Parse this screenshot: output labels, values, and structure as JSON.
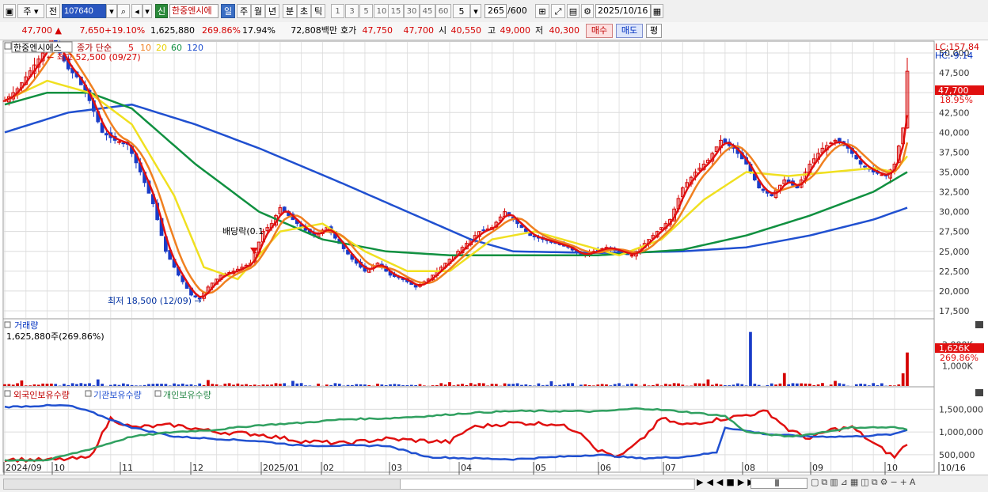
{
  "toolbar": {
    "type_label": "주",
    "prev_label": "전",
    "code": "107640",
    "new_badge": "신",
    "stock_name": "한중엔시에",
    "periods": [
      "일",
      "주",
      "월",
      "년",
      "분",
      "초",
      "틱"
    ],
    "active_period": "일",
    "intervals": [
      "1",
      "3",
      "5",
      "10",
      "15",
      "30",
      "45",
      "60"
    ],
    "interval_value": "5",
    "count_value": "265",
    "count_total": "/600",
    "date": "2025/10/16"
  },
  "quote": {
    "price": "47,700",
    "change": "7,650",
    "change_pct": "+19.10%",
    "volume": "1,625,880",
    "volume_ratio": "269.86%",
    "turnover": "17.94%",
    "amount": "72,808백만",
    "ask_label": "호가",
    "ask": "47,750",
    "bid": "47,700",
    "open_label": "시",
    "open": "40,550",
    "high_label": "고",
    "high": "49,000",
    "low_label": "저",
    "low": "40,300",
    "buy_label": "매수",
    "sell_label": "매도",
    "eval_label": "평"
  },
  "price_panel": {
    "legend_name": "한중엔시에스",
    "legend_ma_label": "종가 단순",
    "ma_periods": [
      "5",
      "10",
      "20",
      "60",
      "120"
    ],
    "lc_label": "LC:157.84",
    "hc_label": "HC:-9.14",
    "current_price_tag": "47,700",
    "current_pct_tag": "18.95%",
    "max_annotation": "최고 52,500 (09/27)",
    "min_annotation": "최저 18,500 (12/09)",
    "dividend_annotation": "배당락(0.1"
  },
  "volume_panel": {
    "title": "거래량",
    "value_text": "1,625,880주(269.86%)",
    "tag_value": "1,626K",
    "tag_pct": "269.86%"
  },
  "holder_panel": {
    "legend": [
      "외국인보유수량",
      "기관보유수량",
      "개인보유수량"
    ]
  },
  "x_axis_labels": [
    "2024/09",
    "10",
    "11",
    "12",
    "2025/01",
    "02",
    "03",
    "04",
    "05",
    "06",
    "07",
    "08",
    "09",
    "10",
    "10/16"
  ],
  "colors": {
    "up": "#d40000",
    "down": "#1a3cc8",
    "ma5": "#e01010",
    "ma10": "#f08020",
    "ma20": "#f0e020",
    "ma60": "#109040",
    "ma120": "#2050d0",
    "foreign": "#e01010",
    "institution": "#2050d0",
    "individual": "#30a060"
  },
  "chart_data": [
    {
      "type": "candlestick",
      "title": "한중엔시에스",
      "y_ticks": [
        17500,
        20000,
        22500,
        25000,
        27500,
        30000,
        32500,
        35000,
        37500,
        40000,
        42500,
        45000,
        47500,
        50000
      ],
      "ylim": [
        16500,
        51500
      ],
      "close_points": [
        [
          0,
          44000
        ],
        [
          3,
          45500
        ],
        [
          5,
          47000
        ],
        [
          7,
          48500
        ],
        [
          9,
          50000
        ],
        [
          11,
          52000
        ],
        [
          13,
          50000
        ],
        [
          15,
          48000
        ],
        [
          17,
          47000
        ],
        [
          20,
          44000
        ],
        [
          23,
          40000
        ],
        [
          26,
          39000
        ],
        [
          29,
          38500
        ],
        [
          32,
          35000
        ],
        [
          35,
          31000
        ],
        [
          38,
          25000
        ],
        [
          41,
          22000
        ],
        [
          44,
          19500
        ],
        [
          46,
          19000
        ],
        [
          48,
          20500
        ],
        [
          51,
          22000
        ],
        [
          54,
          22500
        ],
        [
          58,
          23500
        ],
        [
          61,
          27500
        ],
        [
          63,
          28500
        ],
        [
          65,
          30500
        ],
        [
          67,
          29500
        ],
        [
          70,
          28000
        ],
        [
          73,
          27000
        ],
        [
          76,
          28000
        ],
        [
          79,
          26000
        ],
        [
          82,
          24000
        ],
        [
          85,
          22500
        ],
        [
          88,
          23500
        ],
        [
          91,
          22000
        ],
        [
          94,
          21500
        ],
        [
          97,
          20500
        ],
        [
          100,
          21500
        ],
        [
          103,
          23000
        ],
        [
          106,
          24500
        ],
        [
          109,
          26000
        ],
        [
          112,
          27500
        ],
        [
          115,
          28000
        ],
        [
          118,
          30000
        ],
        [
          121,
          28500
        ],
        [
          124,
          27000
        ],
        [
          127,
          26500
        ],
        [
          130,
          26000
        ],
        [
          133,
          25500
        ],
        [
          136,
          24500
        ],
        [
          139,
          25000
        ],
        [
          142,
          25500
        ],
        [
          145,
          25000
        ],
        [
          148,
          24500
        ],
        [
          151,
          26000
        ],
        [
          154,
          27500
        ],
        [
          157,
          29000
        ],
        [
          160,
          33000
        ],
        [
          163,
          35000
        ],
        [
          166,
          36500
        ],
        [
          169,
          39000
        ],
        [
          172,
          38000
        ],
        [
          175,
          36000
        ],
        [
          178,
          33000
        ],
        [
          181,
          32000
        ],
        [
          184,
          34000
        ],
        [
          187,
          33000
        ],
        [
          190,
          36000
        ],
        [
          193,
          38000
        ],
        [
          196,
          39000
        ],
        [
          199,
          38000
        ],
        [
          202,
          36000
        ],
        [
          205,
          35000
        ],
        [
          208,
          34500
        ],
        [
          210,
          36000
        ],
        [
          212,
          40550
        ],
        [
          213,
          47700
        ]
      ],
      "ma20_points": [
        [
          0,
          44000
        ],
        [
          10,
          46500
        ],
        [
          20,
          45000
        ],
        [
          30,
          41000
        ],
        [
          40,
          32000
        ],
        [
          47,
          23000
        ],
        [
          55,
          21500
        ],
        [
          65,
          27500
        ],
        [
          75,
          28500
        ],
        [
          85,
          25000
        ],
        [
          95,
          22500
        ],
        [
          105,
          22500
        ],
        [
          115,
          26500
        ],
        [
          125,
          27500
        ],
        [
          135,
          26000
        ],
        [
          145,
          24500
        ],
        [
          155,
          26500
        ],
        [
          165,
          31500
        ],
        [
          175,
          35000
        ],
        [
          185,
          34500
        ],
        [
          195,
          35000
        ],
        [
          205,
          35500
        ],
        [
          210,
          35000
        ],
        [
          213,
          37000
        ]
      ],
      "ma60_points": [
        [
          0,
          43500
        ],
        [
          10,
          45000
        ],
        [
          20,
          45000
        ],
        [
          30,
          43000
        ],
        [
          45,
          36000
        ],
        [
          60,
          30000
        ],
        [
          75,
          26500
        ],
        [
          90,
          25000
        ],
        [
          105,
          24500
        ],
        [
          120,
          24500
        ],
        [
          140,
          24500
        ],
        [
          160,
          25200
        ],
        [
          175,
          27000
        ],
        [
          190,
          29500
        ],
        [
          205,
          32500
        ],
        [
          213,
          35000
        ]
      ],
      "ma120_points": [
        [
          0,
          40000
        ],
        [
          15,
          42500
        ],
        [
          30,
          43500
        ],
        [
          45,
          41000
        ],
        [
          60,
          38000
        ],
        [
          80,
          33500
        ],
        [
          95,
          30000
        ],
        [
          110,
          26500
        ],
        [
          120,
          25000
        ],
        [
          140,
          24800
        ],
        [
          160,
          25000
        ],
        [
          175,
          25500
        ],
        [
          190,
          27000
        ],
        [
          205,
          29000
        ],
        [
          213,
          30500
        ]
      ],
      "annotations": [
        "최고 52,500 (09/27)",
        "최저 18,500 (12/09)"
      ]
    },
    {
      "type": "bar",
      "title": "거래량",
      "y_ticks": [
        1000000,
        2000000
      ],
      "ylim": [
        0,
        3000000
      ],
      "spikes": [
        [
          4,
          300000
        ],
        [
          22,
          350000
        ],
        [
          48,
          320000
        ],
        [
          68,
          280000
        ],
        [
          105,
          220000
        ],
        [
          129,
          260000
        ],
        [
          166,
          350000
        ],
        [
          176,
          2600000
        ],
        [
          184,
          650000
        ],
        [
          196,
          280000
        ],
        [
          212,
          640000
        ],
        [
          213,
          1625880
        ]
      ]
    },
    {
      "type": "line",
      "title": "보유수량",
      "y_ticks": [
        500000,
        1000000,
        1500000
      ],
      "ylim": [
        150000,
        1750000
      ],
      "series": [
        {
          "name": "외국인보유수량",
          "points": [
            [
              0,
              400000
            ],
            [
              10,
              380000
            ],
            [
              20,
              430000
            ],
            [
              25,
              1300000
            ],
            [
              30,
              1100000
            ],
            [
              40,
              1150000
            ],
            [
              50,
              1000000
            ],
            [
              60,
              950000
            ],
            [
              70,
              800000
            ],
            [
              80,
              750000
            ],
            [
              90,
              850000
            ],
            [
              100,
              800000
            ],
            [
              105,
              780000
            ],
            [
              110,
              1100000
            ],
            [
              120,
              1200000
            ],
            [
              130,
              1180000
            ],
            [
              136,
              1000000
            ],
            [
              140,
              600000
            ],
            [
              145,
              450000
            ],
            [
              150,
              800000
            ],
            [
              155,
              1300000
            ],
            [
              160,
              1150000
            ],
            [
              170,
              1300000
            ],
            [
              180,
              1450000
            ],
            [
              185,
              1050000
            ],
            [
              190,
              850000
            ],
            [
              195,
              1050000
            ],
            [
              200,
              1100000
            ],
            [
              205,
              750000
            ],
            [
              210,
              450000
            ],
            [
              213,
              750000
            ]
          ]
        },
        {
          "name": "기관보유수량",
          "points": [
            [
              0,
              1550000
            ],
            [
              10,
              1580000
            ],
            [
              15,
              1580000
            ],
            [
              20,
              1450000
            ],
            [
              30,
              1100000
            ],
            [
              40,
              900000
            ],
            [
              50,
              850000
            ],
            [
              60,
              800000
            ],
            [
              70,
              700000
            ],
            [
              80,
              700000
            ],
            [
              90,
              700000
            ],
            [
              100,
              450000
            ],
            [
              110,
              420000
            ],
            [
              120,
              400000
            ],
            [
              130,
              450000
            ],
            [
              140,
              500000
            ],
            [
              150,
              420000
            ],
            [
              160,
              450000
            ],
            [
              168,
              550000
            ],
            [
              170,
              1100000
            ],
            [
              180,
              950000
            ],
            [
              190,
              900000
            ],
            [
              200,
              900000
            ],
            [
              210,
              950000
            ],
            [
              213,
              1050000
            ]
          ]
        },
        {
          "name": "개인보유수량",
          "points": [
            [
              0,
              380000
            ],
            [
              10,
              380000
            ],
            [
              20,
              620000
            ],
            [
              30,
              900000
            ],
            [
              40,
              1000000
            ],
            [
              50,
              1050000
            ],
            [
              60,
              1150000
            ],
            [
              70,
              1200000
            ],
            [
              80,
              1280000
            ],
            [
              90,
              1300000
            ],
            [
              100,
              1350000
            ],
            [
              110,
              1420000
            ],
            [
              120,
              1460000
            ],
            [
              130,
              1460000
            ],
            [
              140,
              1450000
            ],
            [
              150,
              1520000
            ],
            [
              160,
              1450000
            ],
            [
              170,
              1350000
            ],
            [
              175,
              1000000
            ],
            [
              185,
              900000
            ],
            [
              190,
              950000
            ],
            [
              200,
              1100000
            ],
            [
              210,
              1100000
            ],
            [
              213,
              1050000
            ]
          ]
        }
      ]
    }
  ]
}
